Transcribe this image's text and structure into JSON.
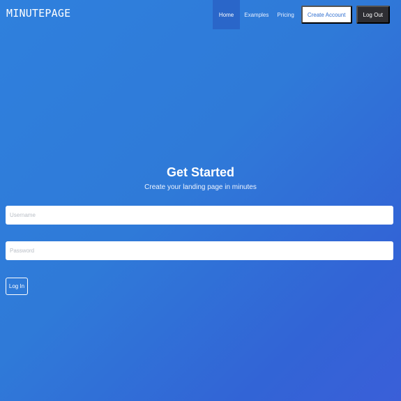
{
  "navbar": {
    "brand": "MINUTEPAGE",
    "links": [
      {
        "label": "Home",
        "active": true
      },
      {
        "label": "Examples",
        "active": false
      },
      {
        "label": "Pricing",
        "active": false
      }
    ],
    "create_account_label": "Create Account",
    "logout_label": "Log Out"
  },
  "hero": {
    "title": "Get Started",
    "subtitle": "Create your landing page in minutes"
  },
  "form": {
    "username_placeholder": "Username",
    "password_placeholder": "Password",
    "login_label": "Log In"
  },
  "colors": {
    "background_gradient_start": "#2f80dd",
    "background_gradient_end": "#3a5fd8",
    "logout_button": "#2e2e33",
    "active_nav": "#2a66c9"
  }
}
